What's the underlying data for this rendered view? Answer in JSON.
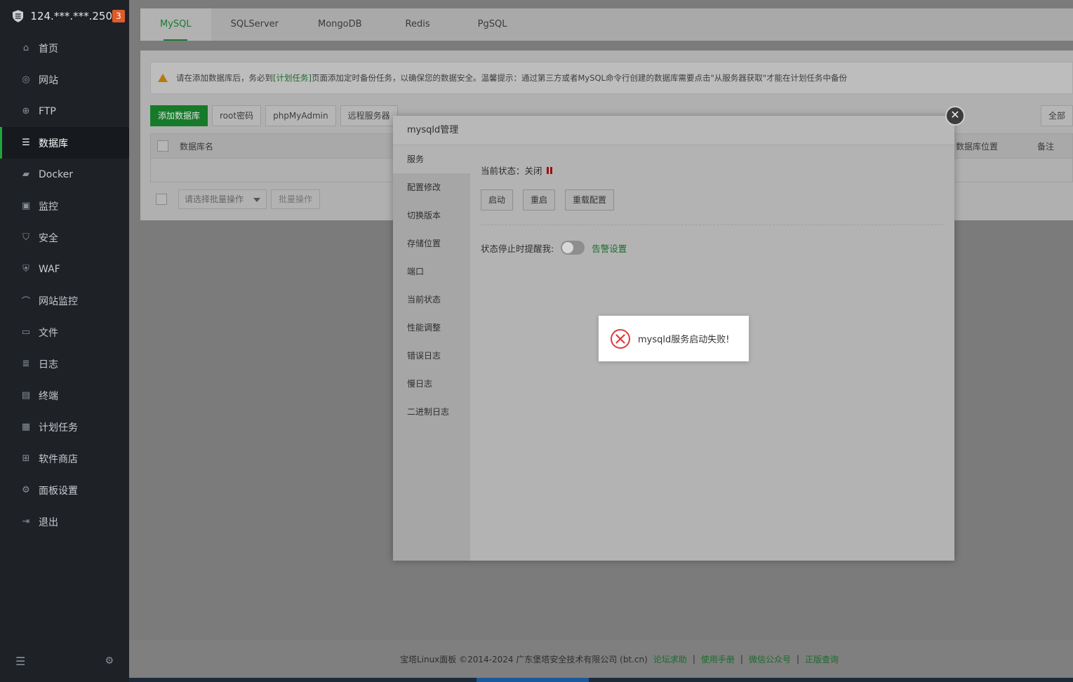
{
  "sidebar": {
    "server_ip": "124.***.***.250",
    "badge": "3",
    "items": [
      {
        "label": "首页",
        "icon": "home-icon"
      },
      {
        "label": "网站",
        "icon": "globe-icon"
      },
      {
        "label": "FTP",
        "icon": "ftp-icon"
      },
      {
        "label": "数据库",
        "icon": "database-icon",
        "active": true
      },
      {
        "label": "Docker",
        "icon": "docker-icon"
      },
      {
        "label": "监控",
        "icon": "monitor-icon"
      },
      {
        "label": "安全",
        "icon": "shield-icon"
      },
      {
        "label": "WAF",
        "icon": "waf-icon"
      },
      {
        "label": "网站监控",
        "icon": "chart-icon"
      },
      {
        "label": "文件",
        "icon": "folder-icon"
      },
      {
        "label": "日志",
        "icon": "log-icon"
      },
      {
        "label": "终端",
        "icon": "terminal-icon"
      },
      {
        "label": "计划任务",
        "icon": "calendar-icon"
      },
      {
        "label": "软件商店",
        "icon": "grid-icon"
      },
      {
        "label": "面板设置",
        "icon": "gear-icon"
      },
      {
        "label": "退出",
        "icon": "logout-icon"
      }
    ]
  },
  "tabs": [
    {
      "label": "MySQL",
      "active": true
    },
    {
      "label": "SQLServer"
    },
    {
      "label": "MongoDB"
    },
    {
      "label": "Redis"
    },
    {
      "label": "PgSQL"
    }
  ],
  "notice": {
    "prefix": "请在添加数据库后，务必到",
    "link": "[计划任务]",
    "suffix": "页面添加定时备份任务，以确保您的数据安全。温馨提示：通过第三方或者MySQL命令行创建的数据库需要点击\"从服务器获取\"才能在计划任务中备份"
  },
  "toolbar": {
    "add_db": "添加数据库",
    "root_pwd": "root密码",
    "phpmyadmin": "phpMyAdmin",
    "remote": "远程服务器",
    "all": "全部"
  },
  "table": {
    "col_name": "数据库名",
    "col_location": "数据库位置",
    "col_note": "备注"
  },
  "batch": {
    "placeholder": "请选择批量操作",
    "button": "批量操作"
  },
  "footer": {
    "copyright": "宝塔Linux面板 ©2014-2024 广东堡塔安全技术有限公司 (bt.cn)",
    "links": [
      "论坛求助",
      "使用手册",
      "微信公众号",
      "正版查询"
    ]
  },
  "modal": {
    "title": "mysqld管理",
    "menu": [
      "服务",
      "配置修改",
      "切换版本",
      "存储位置",
      "端口",
      "当前状态",
      "性能调整",
      "错误日志",
      "慢日志",
      "二进制日志"
    ],
    "status_label": "当前状态：",
    "status_value": "关闭",
    "buttons": {
      "start": "启动",
      "restart": "重启",
      "reload": "重载配置"
    },
    "alert_label": "状态停止时提醒我:",
    "alert_link": "告警设置"
  },
  "toast": {
    "message": "mysqld服务启动失败!"
  },
  "colors": {
    "accent": "#20a53a",
    "error": "#e0393e",
    "badge": "#e05b2a"
  }
}
